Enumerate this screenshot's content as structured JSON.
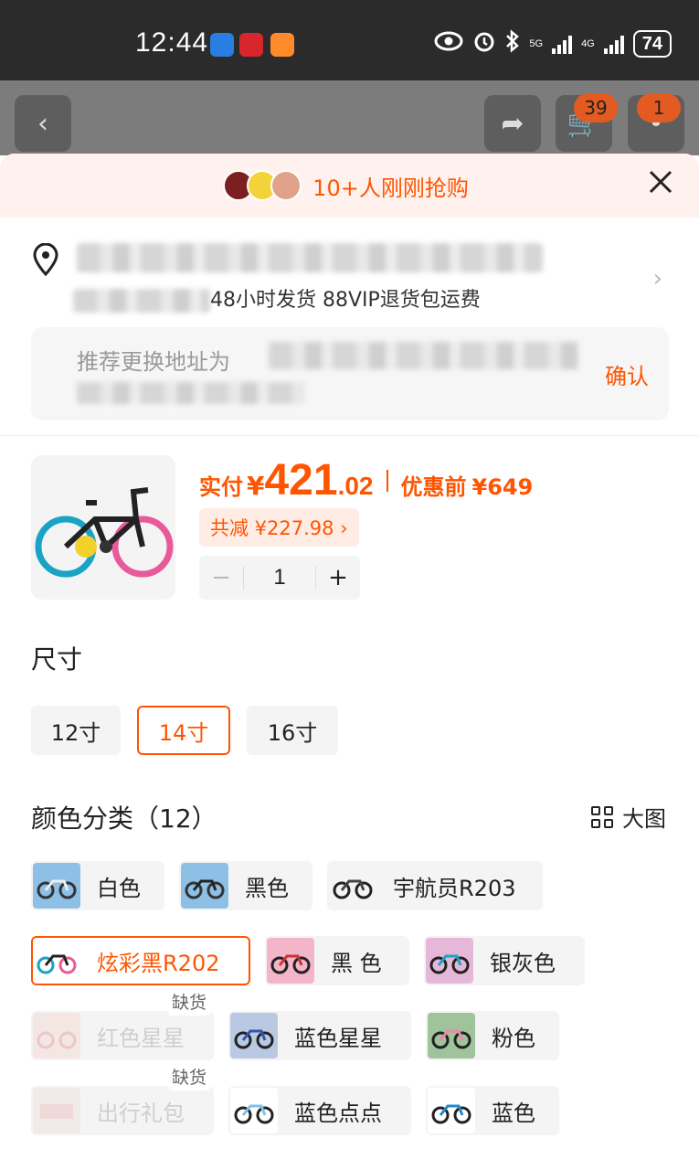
{
  "status_bar": {
    "time": "12:44",
    "battery": "74",
    "signal1": "5G",
    "signal2": "4G"
  },
  "top_bar": {
    "cart_count": "39",
    "msg_count": "1"
  },
  "banner": {
    "text": "10+人刚刚抢购"
  },
  "address": {
    "sub": "48小时发货 88VIP退货包运费",
    "recommend_label": "推荐更换地址为",
    "confirm": "确认"
  },
  "product": {
    "paid_label": "实付",
    "currency": "¥",
    "price_int": "421",
    "price_dec": ".02",
    "orig_label": "优惠前",
    "orig_price": "¥649",
    "discount": "共减 ¥227.98 ›",
    "minus": "−",
    "qty": "1",
    "plus": "+"
  },
  "size": {
    "title": "尺寸",
    "options": [
      "12寸",
      "14寸",
      "16寸"
    ],
    "selected": "14寸"
  },
  "color": {
    "title": "颜色分类（12）",
    "big_image": "大图",
    "out_of_stock": "缺货",
    "options": [
      "白色",
      "黑色",
      "宇航员R203",
      "炫彩黑R202",
      "黑 色",
      "银灰色",
      "红色星星",
      "蓝色星星",
      "粉色",
      "出行礼包",
      "蓝色点点",
      "蓝色"
    ],
    "selected": "炫彩黑R202"
  },
  "colors": {
    "accent": "#ff5500",
    "banner_bg": "#fff2ee",
    "chip_bg": "#f4f4f4"
  }
}
